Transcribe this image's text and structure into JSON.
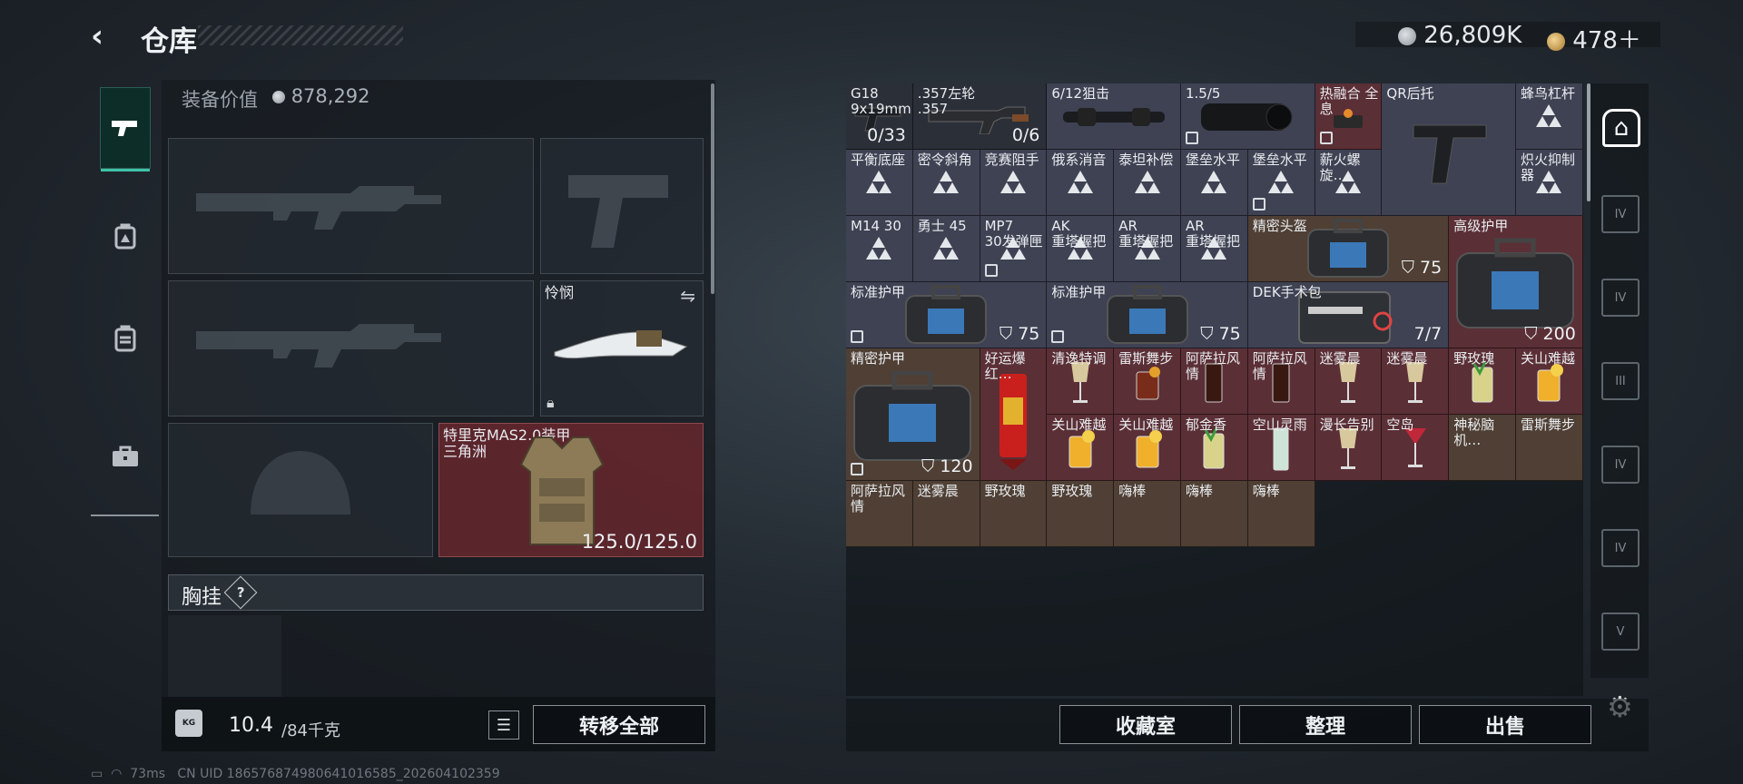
{
  "header": {
    "title": "仓库",
    "back_icon": "back-arrow-icon"
  },
  "currency": [
    {
      "icon": "silver-coin-icon",
      "value": "26,809K"
    },
    {
      "icon": "gold-coin-icon",
      "value": "478＋"
    }
  ],
  "left_rail": [
    {
      "icon": "pistol-icon",
      "active": true
    },
    {
      "icon": "backpack-armor-icon"
    },
    {
      "icon": "backpack-icon"
    },
    {
      "icon": "briefcase-icon"
    }
  ],
  "equipment": {
    "value_label": "装备价值",
    "value": "878,292",
    "melee_name": "怜悯",
    "vest_name": "特里克MAS2.0装甲\n三角洲",
    "vest_durability": "125.0/125.0",
    "chest_label": "胸挂",
    "chest_help": "?"
  },
  "footer_left": {
    "weight": "10.4",
    "weight_unit": "/84千克",
    "transfer": "转移全部"
  },
  "grid": [
    {
      "name": "G18\n9x19mm",
      "count": "0/33",
      "cls": "c-gray",
      "art": "pistol"
    },
    {
      "name": ".357左轮\n.357",
      "count": "0/6",
      "cls": "c-gray",
      "art": "revolver",
      "w": 2
    },
    {
      "name": "6/12狙击",
      "cls": "c-std",
      "art": "scope",
      "w": 2
    },
    {
      "name": "1.5/5",
      "cls": "c-std",
      "art": "scope2",
      "w": 2,
      "badge": true
    },
    {
      "name": "热融合 全息",
      "cls": "c-red",
      "art": "holo",
      "badge": true
    },
    {
      "name": "QR后托",
      "cls": "c-std",
      "art": "stock",
      "w": 2,
      "h": 2
    },
    {
      "name": "蜂鸟杠杆",
      "cls": "c-std",
      "art": "tri"
    },
    {
      "name": "平衡底座",
      "cls": "c-std",
      "art": "tri"
    },
    {
      "name": "密令斜角",
      "cls": "c-std",
      "art": "tri"
    },
    {
      "name": "竞赛阻手",
      "cls": "c-std",
      "art": "tri"
    },
    {
      "name": "俄系消音",
      "cls": "c-std",
      "art": "tri"
    },
    {
      "name": "泰坦补偿",
      "cls": "c-std",
      "art": "tri"
    },
    {
      "name": "堡垒水平",
      "cls": "c-std",
      "art": "tri"
    },
    {
      "name": "堡垒水平",
      "cls": "c-std",
      "art": "tri",
      "badge": true
    },
    {
      "name": "薪火螺旋…",
      "cls": "c-std",
      "art": "tri"
    },
    {
      "name": "炽火抑制器",
      "cls": "c-std",
      "art": "tri"
    },
    {
      "name": "M14 30",
      "cls": "c-std",
      "art": "tri"
    },
    {
      "name": "勇士 45",
      "cls": "c-std",
      "art": "tri"
    },
    {
      "name": "MP7\n30发弹匣",
      "cls": "c-std",
      "art": "tri",
      "badge": true
    },
    {
      "name": "AK\n重塔握把",
      "cls": "c-std",
      "art": "tri"
    },
    {
      "name": "AR\n重塔握把",
      "cls": "c-std",
      "art": "tri"
    },
    {
      "name": "AR\n重塔握把",
      "cls": "c-std",
      "art": "tri"
    },
    {
      "name": "精密头盔",
      "cls": "c-brown",
      "art": "bag",
      "w": 3,
      "shield": "75"
    },
    {
      "name": "标准护甲",
      "cls": "c-std",
      "art": "bag",
      "w": 3,
      "shield": "75",
      "badge": true
    },
    {
      "name": "标准护甲",
      "cls": "c-std",
      "art": "bag",
      "w": 3,
      "shield": "75",
      "badge": true
    },
    {
      "name": "DEK手术包",
      "cls": "c-std",
      "art": "medkit",
      "w": 3,
      "count": "7/7"
    },
    {
      "name": "高级护甲",
      "cls": "c-red",
      "art": "bigbag",
      "w": 2,
      "h": 2,
      "shield": "200"
    },
    {
      "name": "精密护甲",
      "cls": "c-brown",
      "art": "bigbag",
      "w": 2,
      "h": 2,
      "shield": "120",
      "badge": true
    },
    {
      "name": "好运爆红…",
      "cls": "c-red",
      "art": "firework",
      "h": 2
    },
    {
      "name": "清逸特调",
      "cls": "c-red",
      "art": "glass"
    },
    {
      "name": "雷斯舞步",
      "cls": "c-red",
      "art": "drink"
    },
    {
      "name": "阿萨拉风情",
      "cls": "c-red",
      "art": "cola"
    },
    {
      "name": "阿萨拉风情",
      "cls": "c-red",
      "art": "cola"
    },
    {
      "name": "迷雾晨",
      "cls": "c-red",
      "art": "glass"
    },
    {
      "name": "迷雾晨",
      "cls": "c-red",
      "art": "glass"
    },
    {
      "name": "野玫瑰",
      "cls": "c-red",
      "art": "mojito"
    },
    {
      "name": "关山难越",
      "cls": "c-red",
      "art": "juice"
    },
    {
      "name": "关山难越",
      "cls": "c-red",
      "art": "juice"
    },
    {
      "name": "关山难越",
      "cls": "c-red",
      "art": "juice"
    },
    {
      "name": "郁金香",
      "cls": "c-red",
      "art": "mojito"
    },
    {
      "name": "空山灵雨",
      "cls": "c-red",
      "art": "tall"
    },
    {
      "name": "漫长告别",
      "cls": "c-red",
      "art": "glass"
    },
    {
      "name": "空岛",
      "cls": "c-red",
      "art": "cocktail"
    },
    {
      "name": "神秘脑机…",
      "cls": "c-brown",
      "art": "none"
    },
    {
      "name": "雷斯舞步",
      "cls": "c-brown",
      "art": "none"
    },
    {
      "name": "阿萨拉风情",
      "cls": "c-brown",
      "art": "none"
    },
    {
      "name": "迷雾晨",
      "cls": "c-brown",
      "art": "none"
    },
    {
      "name": "野玫瑰",
      "cls": "c-brown",
      "art": "none"
    },
    {
      "name": "野玫瑰",
      "cls": "c-brown",
      "art": "none"
    },
    {
      "name": "嗨棒",
      "cls": "c-brown",
      "art": "none"
    },
    {
      "name": "嗨棒",
      "cls": "c-brown",
      "art": "none"
    },
    {
      "name": "嗨棒",
      "cls": "c-brown",
      "art": "none"
    }
  ],
  "right_rail": [
    {
      "label": "IV"
    },
    {
      "label": "IV"
    },
    {
      "label": "III"
    },
    {
      "label": "IV"
    },
    {
      "label": "IV"
    },
    {
      "label": "V"
    }
  ],
  "footer_right": {
    "collect": "收藏室",
    "sort": "整理",
    "sell": "出售"
  },
  "status": {
    "ping": "73ms",
    "uid": "CN UID 1865768749806410165​85_202604102359"
  }
}
